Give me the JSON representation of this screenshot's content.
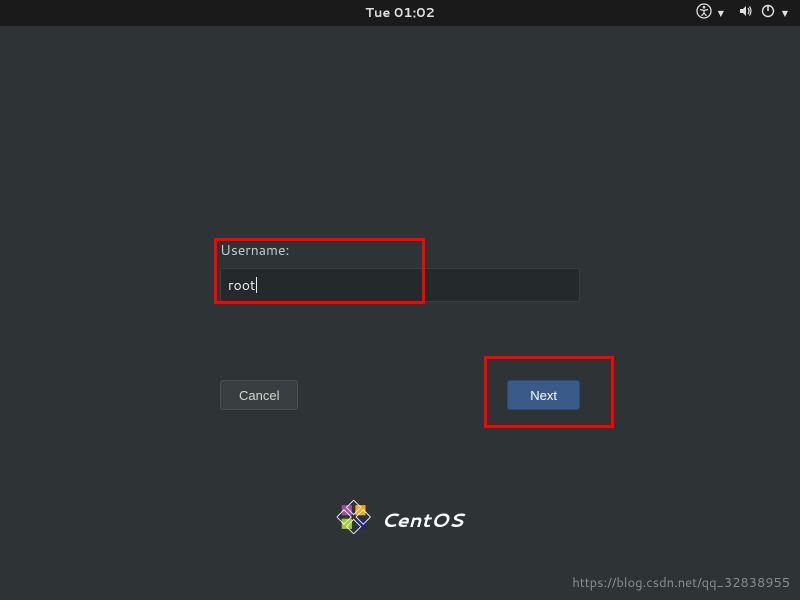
{
  "topbar": {
    "datetime": "Tue 01:02"
  },
  "login": {
    "username_label": "Username:",
    "username_value": "root",
    "cancel_label": "Cancel",
    "next_label": "Next"
  },
  "branding": {
    "name": "CentOS"
  },
  "watermark": "https://blog.csdn.net/qq_32838955"
}
